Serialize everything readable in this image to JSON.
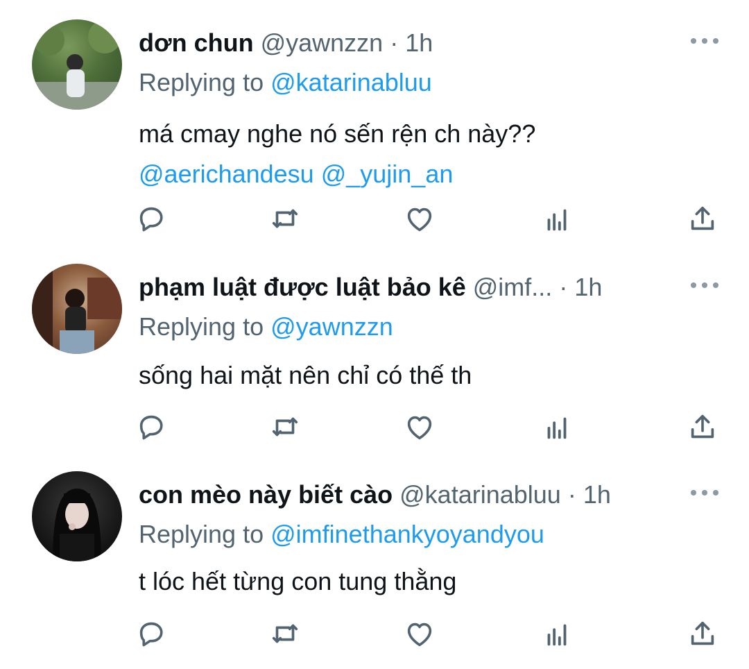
{
  "tweets": [
    {
      "name": "dơn chun",
      "handle": "@yawnzzn",
      "separator": "·",
      "time": "1h",
      "replying_prefix": "Replying to",
      "replying_to": "@katarinabluu",
      "text": "má cmay nghe nó sến rện ch này??",
      "mentions": "@aerichandesu @_yujin_an"
    },
    {
      "name": "phạm luật được luật bảo kê",
      "handle": "@imf...",
      "separator": "·",
      "time": "1h",
      "replying_prefix": "Replying to",
      "replying_to": "@yawnzzn",
      "text": "sống hai mặt nên chỉ có thế th",
      "mentions": ""
    },
    {
      "name": "con mèo này biết cào",
      "handle": "@katarinabluu",
      "separator": "·",
      "time": "1h",
      "replying_prefix": "Replying to",
      "replying_to": "@imfinethankyoyandyou",
      "text": "t lóc hết từng con tung thằng",
      "mentions": ""
    }
  ],
  "icons": {
    "more": "more-icon",
    "reply": "reply-icon",
    "retweet": "retweet-icon",
    "like": "heart-icon",
    "views": "views-icon",
    "share": "share-icon"
  },
  "colors": {
    "text": "#0f1419",
    "secondary": "#536471",
    "link": "#1d9bf0",
    "icon": "#536471"
  }
}
